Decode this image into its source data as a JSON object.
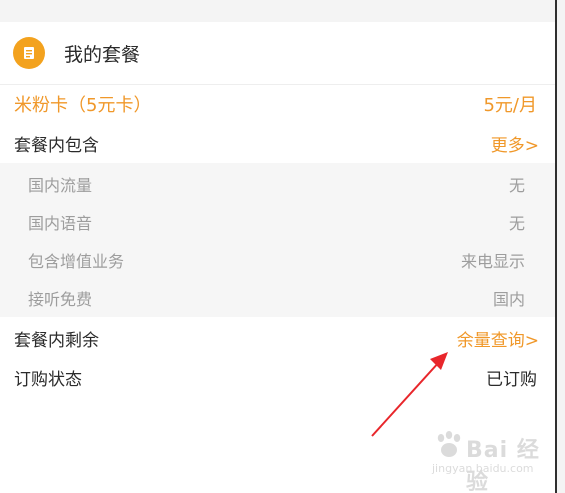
{
  "card": {
    "title": "我的套餐",
    "icon": "package-icon"
  },
  "plan": {
    "name": "米粉卡（5元卡）",
    "price": "5元/月"
  },
  "included": {
    "label": "套餐内包含",
    "more_link": "更多>"
  },
  "details": [
    {
      "label": "国内流量",
      "value": "无"
    },
    {
      "label": "国内语音",
      "value": "无"
    },
    {
      "label": "包含增值业务",
      "value": "来电显示"
    },
    {
      "label": "接听免费",
      "value": "国内"
    }
  ],
  "remaining": {
    "label": "套餐内剩余",
    "query_link": "余量查询>"
  },
  "subscription": {
    "label": "订购状态",
    "value": "已订购"
  },
  "watermark": {
    "logo_text": "Bai 经验",
    "domain": "jingyan.baidu.com"
  },
  "colors": {
    "accent": "#f0982a",
    "icon_bg": "#f3a21e",
    "annotation_arrow": "#e8262b",
    "muted_text": "#9d9d9d"
  }
}
